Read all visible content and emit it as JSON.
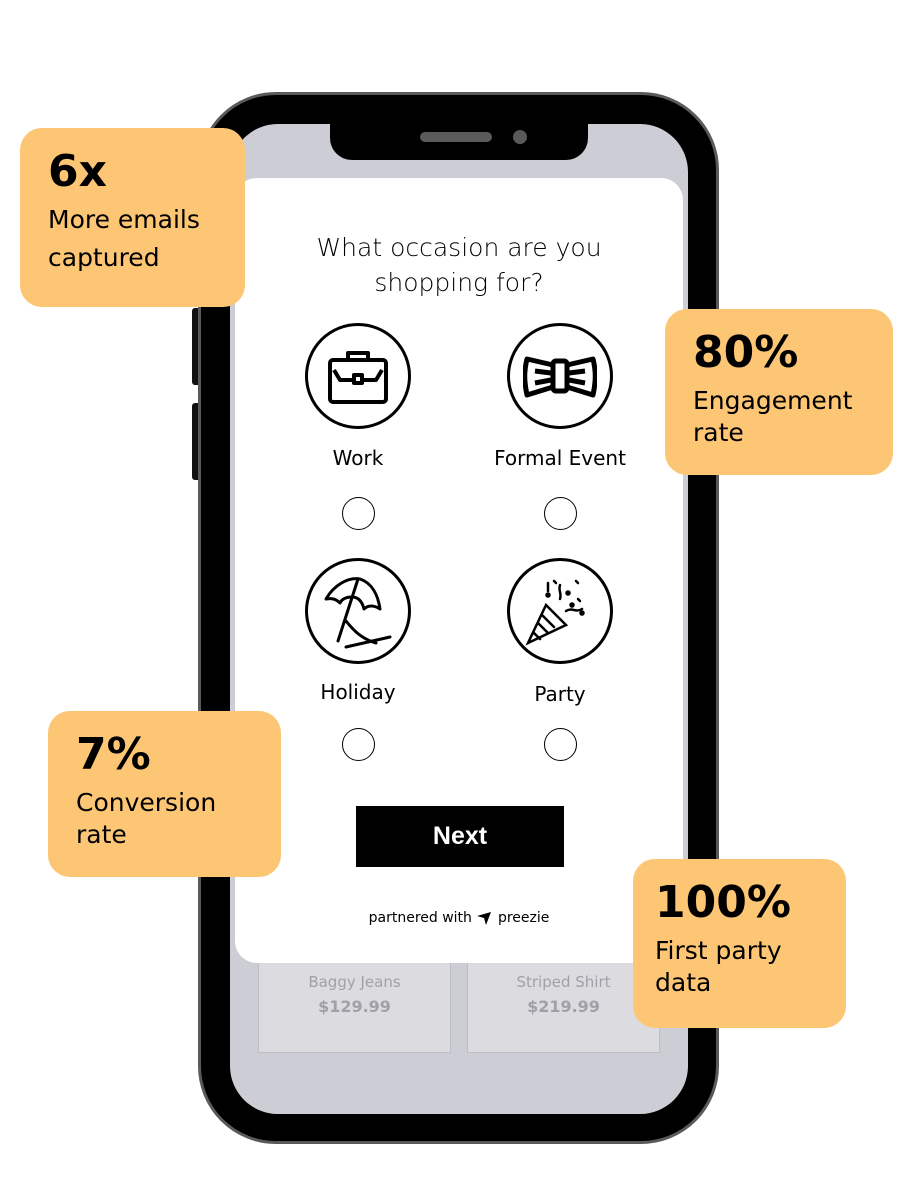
{
  "quiz": {
    "question_line1": "What occasion are you",
    "question_line2": "shopping for?",
    "options": [
      {
        "label": "Work",
        "icon": "briefcase-icon",
        "selected": false
      },
      {
        "label": "Formal Event",
        "icon": "bow-tie-icon",
        "selected": false
      },
      {
        "label": "Holiday",
        "icon": "beach-umbrella-icon",
        "selected": false
      },
      {
        "label": "Party",
        "icon": "party-popper-icon",
        "selected": false
      }
    ],
    "next_label": "Next",
    "partnered_text": "partnered with",
    "brand": "preezie"
  },
  "products": [
    {
      "name": "Baggy Jeans",
      "price": "$129.99"
    },
    {
      "name": "Striped Shirt",
      "price": "$219.99"
    }
  ],
  "stats": [
    {
      "value": "6x",
      "line1": "More emails",
      "line2": "captured"
    },
    {
      "value": "80%",
      "line1": "Engagement",
      "line2": "rate"
    },
    {
      "value": "7%",
      "line1": "Conversion",
      "line2": "rate"
    },
    {
      "value": "100%",
      "line1": "First party",
      "line2": "data"
    }
  ],
  "colors": {
    "stat_bg": "#fdc675",
    "screen_bg": "#cdcdd5",
    "button": "#000000"
  }
}
